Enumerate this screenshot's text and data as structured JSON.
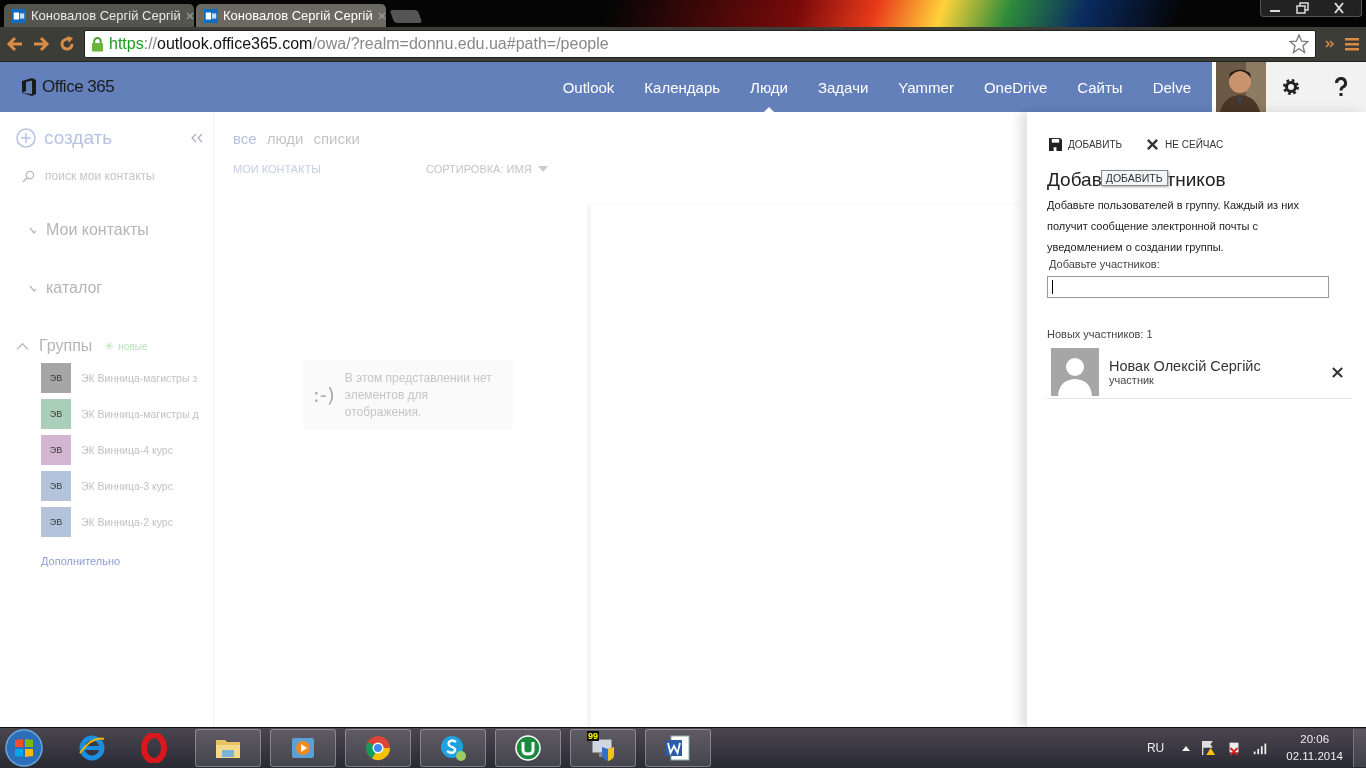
{
  "browser": {
    "tabs": [
      {
        "title": "Коновалов Сергій Сергій",
        "selected": false
      },
      {
        "title": "Коновалов Сергій Сергій",
        "selected": true
      }
    ],
    "address": {
      "scheme": "https",
      "separator": "://",
      "host": "outlook.office365.com",
      "path": "/owa/?realm=donnu.edu.ua#path=/people"
    }
  },
  "app": {
    "brand": "Office 365",
    "nav": [
      {
        "label": "Outlook",
        "selected": false
      },
      {
        "label": "Календарь",
        "selected": false
      },
      {
        "label": "Люди",
        "selected": true
      },
      {
        "label": "Задачи",
        "selected": false
      },
      {
        "label": "Yammer",
        "selected": false
      },
      {
        "label": "OneDrive",
        "selected": false
      },
      {
        "label": "Сайты",
        "selected": false
      },
      {
        "label": "Delve",
        "selected": false
      }
    ]
  },
  "sidebar": {
    "create": "создать",
    "search": {
      "placeholder": "поиск мои контакты"
    },
    "sections": [
      {
        "label": "Мои контакты",
        "expanded": false
      },
      {
        "label": "каталог",
        "expanded": false
      }
    ],
    "groups_header": {
      "label": "Группы",
      "expanded": true,
      "badge": "новые"
    },
    "groups": [
      {
        "initials": "ЭВ",
        "name": "ЭК Винница-магистры з",
        "color": "#a6a6a6"
      },
      {
        "initials": "ЭВ",
        "name": "ЭК Винница-магистры д",
        "color": "#a9cfb8"
      },
      {
        "initials": "ЭВ",
        "name": "ЭК Винница-4 курс",
        "color": "#d2b6d2"
      },
      {
        "initials": "ЭВ",
        "name": "ЭК Винница-3 курс",
        "color": "#b3c3dc"
      },
      {
        "initials": "ЭВ",
        "name": "ЭК Винница-2 курс",
        "color": "#b3c3dc"
      }
    ],
    "more": "Дополнительно"
  },
  "list": {
    "filters": [
      {
        "label": "все",
        "selected": true
      },
      {
        "label": "люди",
        "selected": false
      },
      {
        "label": "списки",
        "selected": false
      }
    ],
    "header": "МОИ КОНТАКТЫ",
    "sort": "СОРТИРОВКА: ИМЯ",
    "empty": {
      "emoticon": ":-)",
      "message": "В этом представлении нет элементов для отображения."
    }
  },
  "panel": {
    "actions": [
      {
        "kind": "save",
        "label": "ДОБАВИТЬ"
      },
      {
        "kind": "close",
        "label": "НЕ СЕЙЧАС"
      }
    ],
    "heading_start": "Добав",
    "tooltip": "ДОБАВИТЬ",
    "heading_end": "тников",
    "description": "Добавьте пользователей в группу. Каждый из них получит сообщение электронной почты с уведомлением о создании группы.",
    "field_label": "Добавьте участников:",
    "count": "Новых участников: 1",
    "members": [
      {
        "name": "Новак Олексій Сергійс",
        "role": "участник"
      }
    ]
  },
  "taskbar": {
    "apps": [
      {
        "kind": "ie",
        "active": false
      },
      {
        "kind": "opera",
        "active": false
      },
      {
        "kind": "folder",
        "active": true
      },
      {
        "kind": "media",
        "active": true
      },
      {
        "kind": "chrome",
        "active": true
      },
      {
        "kind": "skype",
        "active": true
      },
      {
        "kind": "torrent",
        "active": true
      },
      {
        "kind": "monitor",
        "active": true,
        "badge": "99"
      },
      {
        "kind": "word",
        "active": true
      }
    ],
    "language": "RU",
    "time": "20:06",
    "date": "02.11.2014"
  }
}
